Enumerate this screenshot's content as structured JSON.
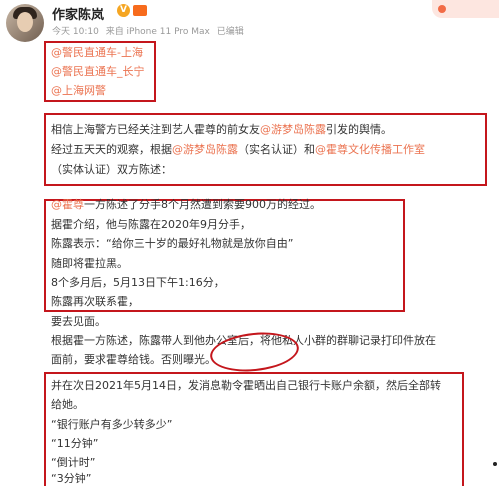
{
  "header": {
    "username": "作家陈岚",
    "v_badge": "V",
    "time": "今天 10:10",
    "source": "来自 iPhone 11 Pro Max",
    "edited": "已编辑"
  },
  "mentions": [
    "@警民直通车-上海",
    "@警民直通车_长宁",
    "@上海网警"
  ],
  "para1": {
    "line1_pre": "相信上海警方已经关注到艺人霍尊的前女友",
    "line1_mention": "@游梦岛陈露",
    "line1_post": "引发的舆情。",
    "line2_pre": "经过五天天的观察，根据",
    "line2_mention1": "@游梦岛陈露",
    "line2_mid": "（实名认证）和",
    "line2_mention2": "@霍尊文化传播工作室",
    "line3": "（实体认证）双方陈述："
  },
  "para2": {
    "line1_mention": "@霍尊",
    "line1_text": "一方陈述了分手8个月然遭到索要900万的经过。",
    "lines": [
      "据霍介绍，他与陈露在2020年9月分手，",
      "陈露表示：“给你三十岁的最好礼物就是放你自由”",
      "随即将霍拉黑。",
      "8个多月后，5月13日下午1:16分，",
      "陈露再次联系霍，",
      "要去见面。",
      "根据霍一方陈述，陈露带人到他办公室后，将他私人小群的群聊记录打印件放在",
      "面前，要求霍尊给钱。否则曝光。"
    ]
  },
  "para3": {
    "lines": [
      "并在次日2021年5月14日，发消息勒令霍晒出自己银行卡账户余额，然后全部转",
      "给她。",
      "“银行账户有多少转多少”",
      "“11分钟”",
      "“倒计时”",
      "“3分钟”"
    ]
  },
  "colors": {
    "highlight_border": "#c4161c",
    "mention": "#eb7350"
  }
}
